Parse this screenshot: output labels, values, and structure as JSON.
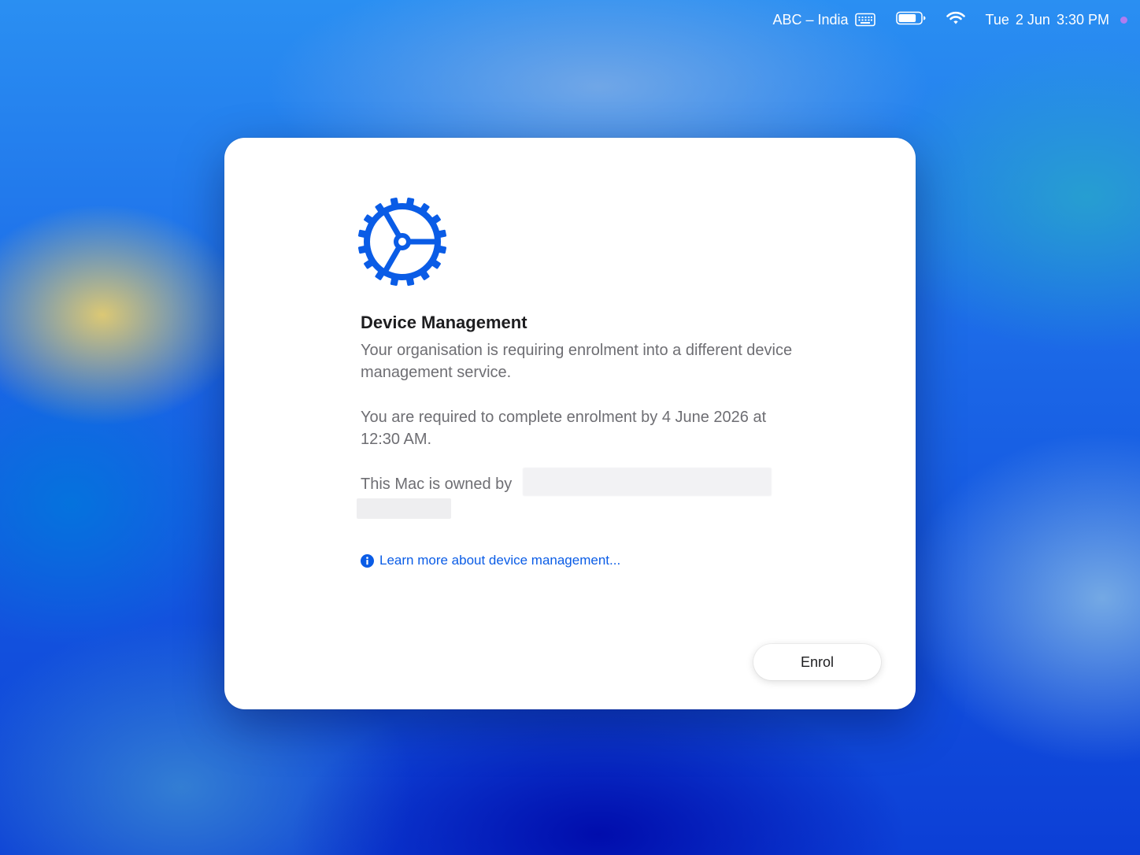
{
  "menubar": {
    "input_source": "ABC – India",
    "input_icon": "keyboard-icon",
    "battery_icon": "battery-icon",
    "battery_level": 0.8,
    "wifi_icon": "wifi-icon",
    "day": "Tue",
    "date": "2 Jun",
    "time": "3:30 PM",
    "indicator_color": "#b07cf0"
  },
  "dialog": {
    "icon": "gear-icon",
    "icon_color": "#0a5ce6",
    "title": "Device Management",
    "message_1": "Your organisation is requiring enrolment into a different device management service.",
    "message_2": "You are required to complete enrolment by 4 June 2026 at 12:30 AM.",
    "owner_prefix": "This Mac is owned by",
    "learn_more": {
      "icon": "info-icon",
      "label": "Learn more about device management..."
    },
    "enrol_button": "Enrol"
  }
}
